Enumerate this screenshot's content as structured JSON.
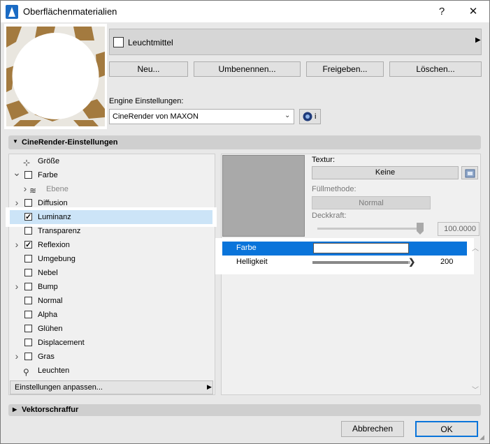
{
  "window": {
    "title": "Oberflächenmaterialien",
    "help_glyph": "?",
    "close_glyph": "✕"
  },
  "header": {
    "material_name": "Leuchtmittel",
    "buttons": [
      "Neu...",
      "Umbenennen...",
      "Freigeben...",
      "Löschen..."
    ],
    "engine_label": "Engine Einstellungen:",
    "engine_value": "CineRender von MAXON",
    "info_label": "i"
  },
  "cinerender": {
    "section_title": "CineRender-Einstellungen",
    "list": [
      {
        "label": "Größe",
        "checkbox": false,
        "checked": false,
        "expand": "",
        "icon": "size-icon"
      },
      {
        "label": "Farbe",
        "checkbox": true,
        "checked": false,
        "expand": "v"
      },
      {
        "label": "Ebene",
        "checkbox": false,
        "checked": false,
        "expand": ">",
        "icon": "layers-icon",
        "indent": true
      },
      {
        "label": "Diffusion",
        "checkbox": true,
        "checked": false,
        "expand": ">"
      },
      {
        "label": "Luminanz",
        "checkbox": true,
        "checked": true,
        "expand": "",
        "selected": true
      },
      {
        "label": "Transparenz",
        "checkbox": true,
        "checked": false,
        "expand": ""
      },
      {
        "label": "Reflexion",
        "checkbox": true,
        "checked": true,
        "expand": ">"
      },
      {
        "label": "Umgebung",
        "checkbox": true,
        "checked": false,
        "expand": ""
      },
      {
        "label": "Nebel",
        "checkbox": true,
        "checked": false,
        "expand": ""
      },
      {
        "label": "Bump",
        "checkbox": true,
        "checked": false,
        "expand": ">"
      },
      {
        "label": "Normal",
        "checkbox": true,
        "checked": false,
        "expand": ""
      },
      {
        "label": "Alpha",
        "checkbox": true,
        "checked": false,
        "expand": ""
      },
      {
        "label": "Glühen",
        "checkbox": true,
        "checked": false,
        "expand": ""
      },
      {
        "label": "Displacement",
        "checkbox": true,
        "checked": false,
        "expand": ""
      },
      {
        "label": "Gras",
        "checkbox": true,
        "checked": false,
        "expand": ">"
      },
      {
        "label": "Leuchten",
        "checkbox": false,
        "checked": false,
        "expand": "",
        "icon": "light-bulb-icon"
      }
    ],
    "customize_label": "Einstellungen anpassen...",
    "texture_label": "Textur:",
    "texture_value": "Keine",
    "fill_label": "Füllmethode:",
    "fill_value": "Normal",
    "opacity_label": "Deckkraft:",
    "opacity_value": "100.0000",
    "opacity_level": 1.0,
    "params": [
      {
        "label": "Farbe",
        "selected": true
      },
      {
        "label": "Helligkeit",
        "value": "200",
        "level": 0.98
      }
    ]
  },
  "vektor": {
    "section_title": "Vektorschraffur"
  },
  "footer": {
    "cancel": "Abbrechen",
    "ok": "OK"
  }
}
